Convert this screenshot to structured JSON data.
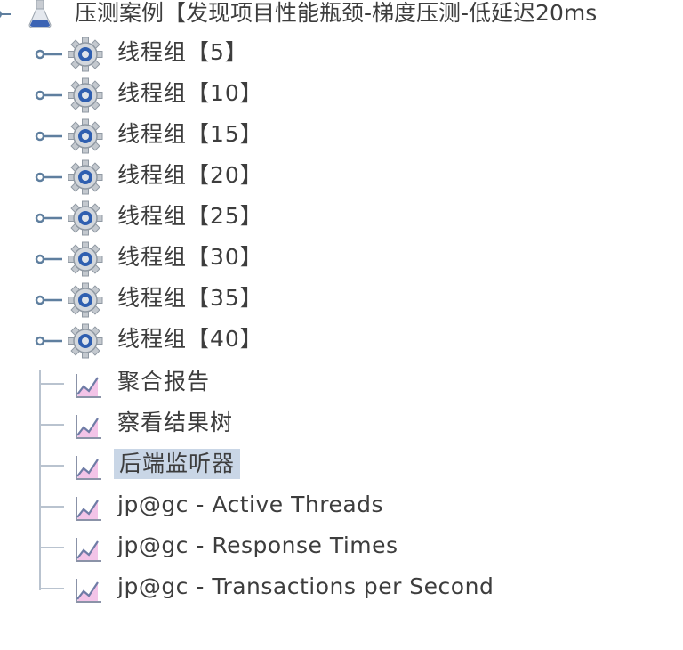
{
  "tree": {
    "root": {
      "label": "压测案例【发现项目性能瓶颈-梯度压测-低延迟20ms"
    },
    "thread_groups": [
      {
        "label": "线程组【5】"
      },
      {
        "label": "线程组【10】"
      },
      {
        "label": "线程组【15】"
      },
      {
        "label": "线程组【20】"
      },
      {
        "label": "线程组【25】"
      },
      {
        "label": "线程组【30】"
      },
      {
        "label": "线程组【35】"
      },
      {
        "label": "线程组【40】"
      }
    ],
    "listeners": [
      {
        "label": "聚合报告"
      },
      {
        "label": "察看结果树"
      },
      {
        "label": "后端监听器"
      },
      {
        "label": "jp@gc - Active Threads"
      },
      {
        "label": "jp@gc - Response Times"
      },
      {
        "label": "jp@gc - Transactions per Second"
      }
    ],
    "selected_label": "后端监听器"
  }
}
